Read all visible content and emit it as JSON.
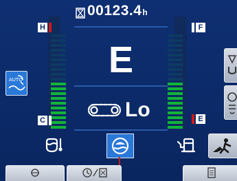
{
  "hour_meter": {
    "value": "00123.4",
    "unit": "h"
  },
  "work_mode": {
    "label": "E"
  },
  "travel_speed": {
    "label": "Lo"
  },
  "coolant_gauge": {
    "top_mark": "H",
    "bottom_mark": "C",
    "level": 0.5
  },
  "fuel_gauge": {
    "top_mark": "F",
    "bottom_mark": "E",
    "level": 0.5
  },
  "colors": {
    "background": "#0c2a66",
    "segment_lit": "#12b43a",
    "segment_dim": "#0d3a64",
    "accent_red": "#d01818",
    "selected_key": "#2a78d8"
  },
  "icons": {
    "auto_decel": "auto-decel-icon",
    "coolant": "coolant-temp-icon",
    "hydraulic_oil": "hydraulic-oil-icon",
    "fuel": "fuel-pump-icon",
    "travel": "crawler-track-icon",
    "hourglass": "hourglass-icon",
    "attachment": "attachment-mode-icon",
    "maintenance": "maintenance-icon",
    "operator": "operator-icon",
    "tab1": "engine-icon",
    "tab2": "clock-camera-icon",
    "tab3": "document-icon"
  }
}
